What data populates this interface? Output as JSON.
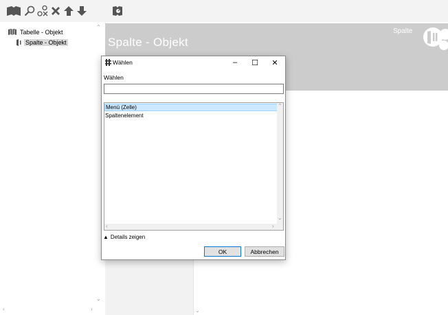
{
  "toolbar": {
    "icons": [
      "table-icon",
      "search-icon",
      "replace-icon",
      "delete-icon",
      "move-up-icon",
      "move-down-icon",
      "snippet-icon"
    ]
  },
  "tree": {
    "items": [
      {
        "label": "Tabelle - Objekt",
        "icon": "table-icon",
        "selected": false
      },
      {
        "label": "Spalte - Objekt",
        "icon": "column-icon",
        "selected": true
      }
    ]
  },
  "content": {
    "title": "Spalte - Objekt",
    "header_label": "Spalte"
  },
  "dialog": {
    "title": "Wählen",
    "label": "Wählen",
    "search_value": "",
    "items": [
      {
        "label": "Menü (Zelle)",
        "selected": true
      },
      {
        "label": "Spaltenelement",
        "selected": false
      }
    ],
    "details_toggle": "Details zeigen",
    "ok_label": "OK",
    "cancel_label": "Abbrechen",
    "caption_minimize": "–",
    "caption_maximize": "☐",
    "caption_close": "✕"
  },
  "colors": {
    "header_band": "#cccccc",
    "selection": "#cce8ff",
    "selection_border": "#99d1ff",
    "toolbar_bg": "#f3f3f3",
    "column_bg": "#f2f2f2"
  }
}
